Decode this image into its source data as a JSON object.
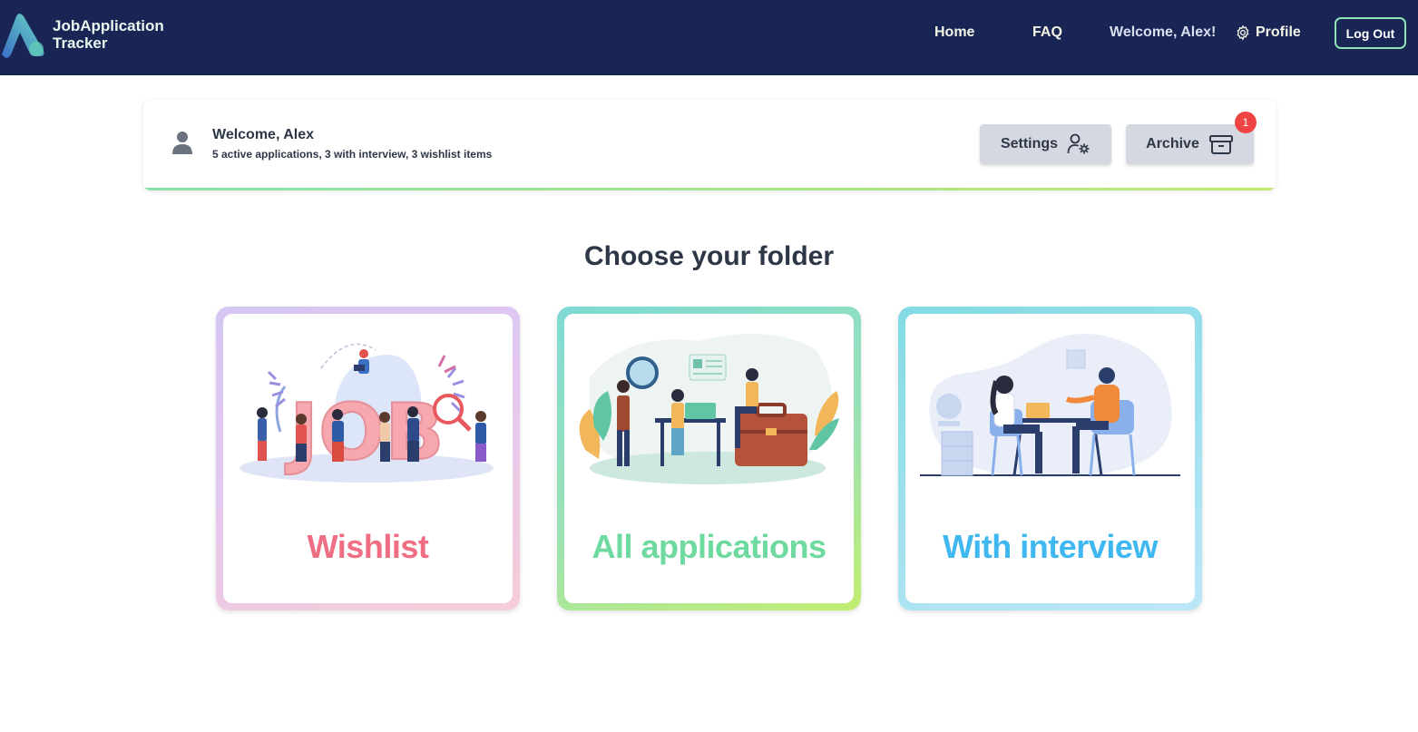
{
  "navbar": {
    "brand_line1": "JobApplication",
    "brand_line2": "Tracker",
    "home": "Home",
    "faq": "FAQ",
    "welcome": "Welcome, Alex!",
    "profile": "Profile",
    "logout": "Log Out"
  },
  "welcome_card": {
    "title": "Welcome, Alex",
    "subtitle": "5 active applications, 3 with interview, 3 wishlist items",
    "settings_label": "Settings",
    "archive_label": "Archive",
    "archive_badge": "1"
  },
  "heading": "Choose your folder",
  "folders": [
    {
      "label": "Wishlist",
      "illustration": "job-search-illustration",
      "color": "#f06e83"
    },
    {
      "label": "All applications",
      "illustration": "office-work-illustration",
      "color": "#6fdaa0"
    },
    {
      "label": "With interview",
      "illustration": "interview-illustration",
      "color": "#3fb7f0"
    }
  ],
  "colors": {
    "navbar_bg": "#192655",
    "logout_border": "#8fe3b5",
    "badge": "#ef4444",
    "button_bg": "#d5d8e0"
  }
}
